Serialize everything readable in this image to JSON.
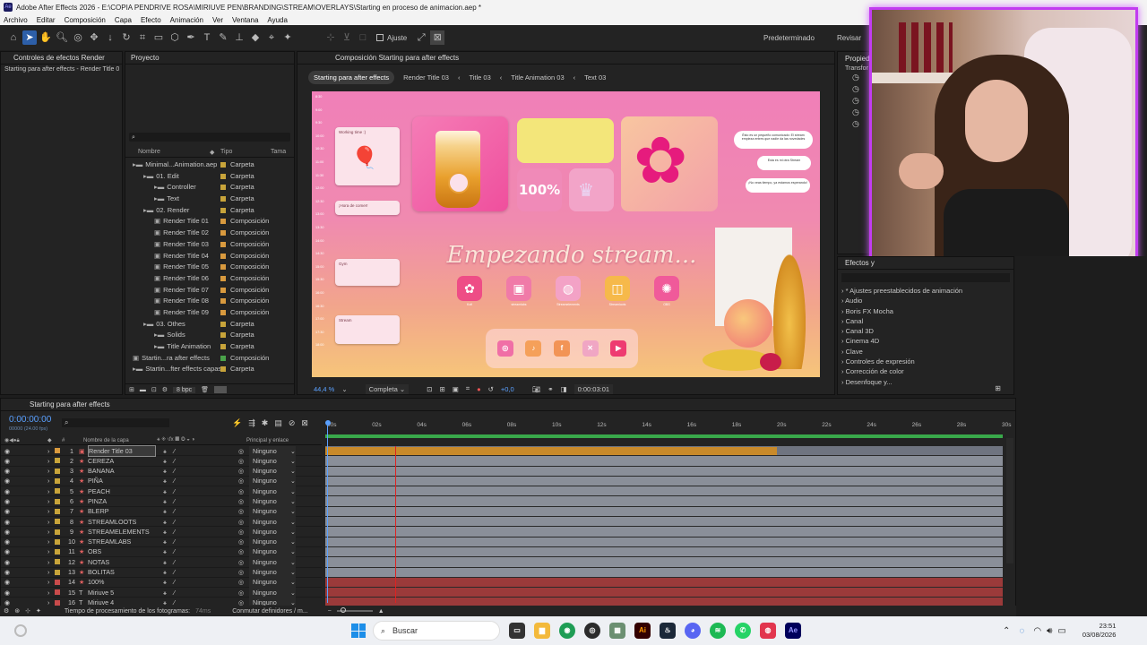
{
  "window": {
    "title": "Adobe After Effects 2026 - E:\\COPIA PENDRIVE ROSA\\MIRIUVE PEN\\BRANDING\\STREAM\\OVERLAYS\\Starting en proceso de animacion.aep *"
  },
  "menu": [
    "Archivo",
    "Editar",
    "Composición",
    "Capa",
    "Efecto",
    "Animación",
    "Ver",
    "Ventana",
    "Ayuda"
  ],
  "toolbar": {
    "snap_label": "Ajuste",
    "workspace_default": "Predeterminado",
    "workspace_review": "Revisar"
  },
  "effect_controls": {
    "title": "Controles de efectos Render",
    "subtitle": "Starting para after effects - Render Title 0"
  },
  "project": {
    "title": "Proyecto",
    "search_placeholder": "",
    "columns": {
      "name": "Nombre",
      "type": "Tipo",
      "size": "Tama"
    },
    "items": [
      {
        "name": "Minimal...Animation.aep",
        "type": "Carpeta",
        "color": "#c8a43a",
        "indent": 0
      },
      {
        "name": "01. Edit",
        "type": "Carpeta",
        "color": "#c8a43a",
        "indent": 1
      },
      {
        "name": "Controller",
        "type": "Carpeta",
        "color": "#c8a43a",
        "indent": 2
      },
      {
        "name": "Text",
        "type": "Carpeta",
        "color": "#c8a43a",
        "indent": 2
      },
      {
        "name": "02. Render",
        "type": "Carpeta",
        "color": "#c8a43a",
        "indent": 1
      },
      {
        "name": "Render Title 01",
        "type": "Composición",
        "color": "#d99a3e",
        "indent": 2
      },
      {
        "name": "Render Title 02",
        "type": "Composición",
        "color": "#d99a3e",
        "indent": 2
      },
      {
        "name": "Render Title 03",
        "type": "Composición",
        "color": "#d99a3e",
        "indent": 2
      },
      {
        "name": "Render Title 04",
        "type": "Composición",
        "color": "#d99a3e",
        "indent": 2
      },
      {
        "name": "Render Title 05",
        "type": "Composición",
        "color": "#d99a3e",
        "indent": 2
      },
      {
        "name": "Render Title 06",
        "type": "Composición",
        "color": "#d99a3e",
        "indent": 2
      },
      {
        "name": "Render Title 07",
        "type": "Composición",
        "color": "#d99a3e",
        "indent": 2
      },
      {
        "name": "Render Title 08",
        "type": "Composición",
        "color": "#d99a3e",
        "indent": 2
      },
      {
        "name": "Render Title 09",
        "type": "Composición",
        "color": "#d99a3e",
        "indent": 2
      },
      {
        "name": "03. Othes",
        "type": "Carpeta",
        "color": "#c8a43a",
        "indent": 1
      },
      {
        "name": "Solids",
        "type": "Carpeta",
        "color": "#c8a43a",
        "indent": 2
      },
      {
        "name": "Title Animation",
        "type": "Carpeta",
        "color": "#c8a43a",
        "indent": 2
      },
      {
        "name": "Startin...ra after effects",
        "type": "Composición",
        "color": "#4aa34a",
        "indent": 0
      },
      {
        "name": "Startin...fter effects capas",
        "type": "Carpeta",
        "color": "#c8a43a",
        "indent": 0
      }
    ],
    "bpc": "8 bpc"
  },
  "composition": {
    "title": "Composición Starting para after effects",
    "tabs": [
      "Starting para after effects",
      "Render Title 03",
      "Title 03",
      "Title Animation 03",
      "Text 03"
    ],
    "zoom": "44,4 %",
    "resolution": "Completa",
    "exposure": "+0,0",
    "timecode": "0:00:03:01",
    "canvas": {
      "heading": "Empezando stream...",
      "percent": "100%",
      "times": [
        "8:30",
        "9:00",
        "9:30",
        "10:00",
        "10:30",
        "11:00",
        "11:30",
        "12:00",
        "12:30",
        "13:00",
        "13:30",
        "14:00",
        "14:30",
        "15:00",
        "15:30",
        "16:00",
        "16:30",
        "17:00",
        "17:30",
        "18:00"
      ],
      "notes": [
        "Working time :)",
        "¡Hora de comer!",
        "Gym",
        "Stream"
      ],
      "bubbles": [
        "Ésto es un pequeño comunicado: El stream empieza entres que nadie da las novedades",
        "Esta es mi otra Stream",
        "¡No veas tiempo, ya estamos esperando!"
      ],
      "apps": [
        "Kofi",
        "streamlabs",
        "Streamelements",
        "Streamloots",
        "OBS"
      ],
      "socials": [
        "instagram",
        "tiktok",
        "facebook",
        "X",
        "youtube"
      ]
    }
  },
  "properties": {
    "title": "Propied",
    "transform": "Transfor"
  },
  "effects": {
    "title": "Efectos y",
    "items": [
      "* Ajustes preestablecidos de animación",
      "Audio",
      "Boris FX Mocha",
      "Canal",
      "Canal 3D",
      "Cinema 4D",
      "Clave",
      "Controles de expresión",
      "Corrección de color",
      "Desenfoque y..."
    ]
  },
  "timeline": {
    "tab": "Starting para after effects",
    "timecode": "0:00:00:00",
    "fps": "00000 (24.00 fps)",
    "columns": {
      "name": "Nombre de la capa",
      "parent": "Principal y enlace"
    },
    "ruler": [
      "00s",
      "02s",
      "04s",
      "06s",
      "08s",
      "10s",
      "12s",
      "14s",
      "16s",
      "18s",
      "20s",
      "22s",
      "24s",
      "26s",
      "28s",
      "30s"
    ],
    "layers": [
      {
        "num": "1",
        "name": "Render Title 03",
        "parent": "Ninguno",
        "color": "#d99a3e",
        "bar": "#c98a2a",
        "selected": true
      },
      {
        "num": "2",
        "name": "CEREZA",
        "parent": "Ninguno",
        "color": "#c8a43a",
        "bar": "#8a8f99"
      },
      {
        "num": "3",
        "name": "BANANA",
        "parent": "Ninguno",
        "color": "#c8a43a",
        "bar": "#8a8f99"
      },
      {
        "num": "4",
        "name": "PIÑA",
        "parent": "Ninguno",
        "color": "#c8a43a",
        "bar": "#8a8f99"
      },
      {
        "num": "5",
        "name": "PEACH",
        "parent": "Ninguno",
        "color": "#c8a43a",
        "bar": "#8a8f99"
      },
      {
        "num": "6",
        "name": "PINZA",
        "parent": "Ninguno",
        "color": "#c8a43a",
        "bar": "#8a8f99"
      },
      {
        "num": "7",
        "name": "BLERP",
        "parent": "Ninguno",
        "color": "#c8a43a",
        "bar": "#8a8f99"
      },
      {
        "num": "8",
        "name": "STREAMLOOTS",
        "parent": "Ninguno",
        "color": "#c8a43a",
        "bar": "#8a8f99"
      },
      {
        "num": "9",
        "name": "STREAMELEMENTS",
        "parent": "Ninguno",
        "color": "#c8a43a",
        "bar": "#8a8f99"
      },
      {
        "num": "10",
        "name": "STREAMLABS",
        "parent": "Ninguno",
        "color": "#c8a43a",
        "bar": "#8a8f99"
      },
      {
        "num": "11",
        "name": "OBS",
        "parent": "Ninguno",
        "color": "#c8a43a",
        "bar": "#8a8f99"
      },
      {
        "num": "12",
        "name": "NOTAS",
        "parent": "Ninguno",
        "color": "#c8a43a",
        "bar": "#8a8f99"
      },
      {
        "num": "13",
        "name": "BOLITAS",
        "parent": "Ninguno",
        "color": "#c8a43a",
        "bar": "#8a8f99"
      },
      {
        "num": "14",
        "name": "100%",
        "parent": "Ninguno",
        "color": "#c94b4b",
        "bar": "#9b3a3a"
      },
      {
        "num": "15",
        "name": "Miriuve 5",
        "parent": "Ninguno",
        "color": "#c94b4b",
        "bar": "#9b3a3a"
      },
      {
        "num": "16",
        "name": "Miriuve 4",
        "parent": "Ninguno",
        "color": "#c94b4b",
        "bar": "#9b3a3a"
      }
    ],
    "footer_left": "Tiempo de procesamiento de los fotogramas:",
    "footer_ms": "74ms",
    "footer_switch": "Conmutar definidores / m..."
  },
  "taskbar": {
    "search_placeholder": "Buscar",
    "time": "23:51",
    "date": "03/08/2026"
  }
}
